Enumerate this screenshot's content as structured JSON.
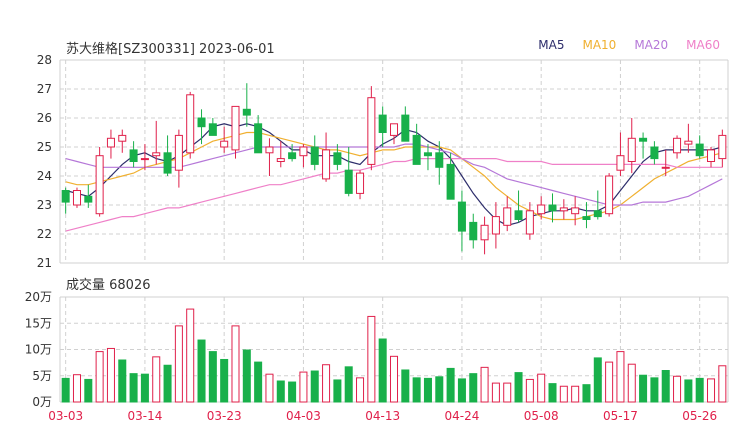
{
  "header": {
    "title": "苏大维格[SZ300331] 2023-06-01"
  },
  "legend": [
    {
      "label": "MA5",
      "color": "#2d2d6b"
    },
    {
      "label": "MA10",
      "color": "#f0b030"
    },
    {
      "label": "MA20",
      "color": "#b577d8"
    },
    {
      "label": "MA60",
      "color": "#ef80c8"
    }
  ],
  "volume_header": {
    "label": "成交量 68026"
  },
  "colors": {
    "up": "#e0204a",
    "down": "#18b04a",
    "grid": "#d0d0d0",
    "axis": "#333333",
    "date": "#e0204a"
  },
  "chart_data": [
    {
      "type": "candlestick",
      "ylim": [
        21,
        28
      ],
      "yticks": [
        "21",
        "22",
        "23",
        "24",
        "25",
        "26",
        "27",
        "28"
      ],
      "xticks": [
        {
          "label": "03-03",
          "index": 0
        },
        {
          "label": "03-14",
          "index": 7
        },
        {
          "label": "03-23",
          "index": 14
        },
        {
          "label": "04-03",
          "index": 21
        },
        {
          "label": "04-13",
          "index": 28
        },
        {
          "label": "04-24",
          "index": 35
        },
        {
          "label": "05-08",
          "index": 42
        },
        {
          "label": "05-17",
          "index": 49
        },
        {
          "label": "05-26",
          "index": 56
        }
      ],
      "ohlc": [
        [
          23.5,
          23.6,
          22.7,
          23.1
        ],
        [
          23.0,
          23.6,
          22.9,
          23.5
        ],
        [
          23.3,
          23.7,
          22.9,
          23.1
        ],
        [
          22.7,
          25.0,
          22.6,
          24.7
        ],
        [
          25.0,
          25.6,
          24.6,
          25.3
        ],
        [
          25.2,
          25.6,
          24.8,
          25.4
        ],
        [
          24.9,
          25.2,
          24.3,
          24.5
        ],
        [
          24.6,
          25.1,
          24.2,
          24.6
        ],
        [
          24.7,
          25.9,
          24.4,
          24.8
        ],
        [
          24.8,
          25.4,
          24.0,
          24.1
        ],
        [
          24.2,
          25.6,
          23.6,
          25.4
        ],
        [
          24.8,
          26.9,
          24.6,
          26.8
        ],
        [
          26.0,
          26.3,
          25.1,
          25.7
        ],
        [
          25.8,
          26.0,
          25.4,
          25.4
        ],
        [
          25.0,
          25.7,
          24.8,
          25.2
        ],
        [
          24.9,
          26.4,
          24.6,
          26.4
        ],
        [
          26.3,
          27.2,
          25.7,
          26.1
        ],
        [
          25.8,
          26.1,
          24.8,
          24.8
        ],
        [
          24.8,
          25.3,
          24.0,
          25.0
        ],
        [
          24.5,
          25.2,
          24.3,
          24.6
        ],
        [
          24.8,
          25.1,
          24.5,
          24.6
        ],
        [
          24.7,
          25.1,
          24.3,
          25.0
        ],
        [
          25.0,
          25.4,
          24.2,
          24.4
        ],
        [
          23.9,
          25.5,
          23.8,
          24.9
        ],
        [
          24.8,
          25.1,
          24.2,
          24.4
        ],
        [
          24.2,
          25.0,
          23.3,
          23.4
        ],
        [
          23.4,
          24.2,
          23.2,
          24.1
        ],
        [
          24.4,
          27.1,
          24.2,
          26.7
        ],
        [
          26.1,
          26.4,
          25.0,
          25.5
        ],
        [
          25.4,
          25.8,
          25.1,
          25.8
        ],
        [
          26.1,
          26.4,
          25.4,
          25.2
        ],
        [
          25.4,
          25.8,
          24.4,
          24.4
        ],
        [
          24.8,
          25.1,
          24.2,
          24.7
        ],
        [
          24.8,
          25.2,
          23.7,
          24.3
        ],
        [
          24.4,
          24.8,
          23.2,
          23.2
        ],
        [
          23.1,
          23.5,
          21.4,
          22.1
        ],
        [
          22.4,
          22.7,
          21.5,
          21.8
        ],
        [
          21.8,
          22.6,
          21.3,
          22.3
        ],
        [
          22.0,
          23.1,
          21.5,
          22.6
        ],
        [
          22.3,
          23.3,
          22.1,
          22.9
        ],
        [
          22.8,
          23.5,
          22.4,
          22.5
        ],
        [
          22.0,
          23.1,
          21.8,
          22.8
        ],
        [
          22.7,
          23.3,
          22.5,
          23.0
        ],
        [
          23.0,
          23.4,
          22.4,
          22.8
        ],
        [
          22.8,
          23.2,
          22.5,
          22.9
        ],
        [
          22.7,
          23.3,
          22.3,
          22.9
        ],
        [
          22.6,
          23.1,
          22.2,
          22.5
        ],
        [
          22.8,
          23.5,
          22.5,
          22.6
        ],
        [
          22.7,
          24.1,
          22.6,
          24.0
        ],
        [
          24.2,
          25.5,
          24.0,
          24.7
        ],
        [
          24.5,
          26.0,
          24.1,
          25.3
        ],
        [
          25.3,
          25.5,
          24.6,
          25.2
        ],
        [
          25.0,
          25.2,
          24.4,
          24.6
        ],
        [
          24.3,
          24.9,
          24.0,
          24.3
        ],
        [
          24.8,
          25.4,
          24.6,
          25.3
        ],
        [
          25.1,
          25.8,
          24.8,
          25.2
        ],
        [
          25.1,
          25.4,
          24.6,
          24.7
        ],
        [
          24.5,
          25.0,
          24.3,
          24.9
        ],
        [
          24.6,
          25.6,
          24.3,
          25.4
        ]
      ],
      "ma5": [
        23.5,
        23.4,
        23.3,
        23.6,
        24.0,
        24.4,
        24.7,
        24.8,
        24.6,
        24.5,
        24.7,
        25.0,
        25.3,
        25.7,
        25.8,
        25.7,
        25.8,
        25.7,
        25.5,
        25.2,
        24.9,
        24.9,
        24.7,
        24.7,
        24.7,
        24.5,
        24.4,
        24.8,
        25.1,
        25.3,
        25.6,
        25.5,
        25.2,
        25.0,
        24.6,
        24.0,
        23.4,
        22.9,
        22.5,
        22.3,
        22.4,
        22.6,
        22.7,
        22.8,
        22.8,
        22.9,
        22.8,
        22.8,
        23.0,
        23.5,
        24.0,
        24.5,
        24.8,
        24.9,
        24.9,
        24.9,
        24.9,
        24.9,
        25.0
      ],
      "ma10": [
        23.8,
        23.7,
        23.7,
        23.8,
        23.9,
        24.0,
        24.1,
        24.3,
        24.4,
        24.5,
        24.6,
        24.8,
        25.0,
        25.2,
        25.3,
        25.4,
        25.5,
        25.5,
        25.4,
        25.3,
        25.2,
        25.1,
        25.0,
        24.9,
        24.9,
        24.8,
        24.7,
        24.8,
        24.9,
        24.9,
        25.0,
        25.0,
        25.0,
        25.0,
        24.9,
        24.6,
        24.3,
        24.0,
        23.6,
        23.3,
        23.0,
        22.8,
        22.6,
        22.5,
        22.5,
        22.5,
        22.6,
        22.7,
        22.8,
        23.0,
        23.3,
        23.6,
        23.9,
        24.1,
        24.3,
        24.5,
        24.6,
        24.7,
        24.8
      ],
      "ma20": [
        24.6,
        24.5,
        24.4,
        24.3,
        24.3,
        24.3,
        24.3,
        24.3,
        24.3,
        24.3,
        24.3,
        24.4,
        24.5,
        24.6,
        24.7,
        24.8,
        24.9,
        25.0,
        25.0,
        25.0,
        25.0,
        25.0,
        25.0,
        25.0,
        25.0,
        25.0,
        25.0,
        25.0,
        25.0,
        25.0,
        25.1,
        25.1,
        25.0,
        24.9,
        24.8,
        24.6,
        24.4,
        24.3,
        24.1,
        23.9,
        23.8,
        23.7,
        23.6,
        23.5,
        23.4,
        23.3,
        23.2,
        23.1,
        23.0,
        23.0,
        23.0,
        23.1,
        23.1,
        23.1,
        23.2,
        23.3,
        23.5,
        23.7,
        23.9
      ],
      "ma60": [
        22.1,
        22.2,
        22.3,
        22.4,
        22.5,
        22.6,
        22.6,
        22.7,
        22.8,
        22.9,
        22.9,
        23.0,
        23.1,
        23.2,
        23.3,
        23.4,
        23.5,
        23.6,
        23.7,
        23.7,
        23.8,
        23.9,
        24.0,
        24.1,
        24.1,
        24.2,
        24.2,
        24.3,
        24.4,
        24.5,
        24.5,
        24.6,
        24.6,
        24.6,
        24.6,
        24.6,
        24.6,
        24.6,
        24.6,
        24.5,
        24.5,
        24.5,
        24.5,
        24.4,
        24.4,
        24.4,
        24.4,
        24.4,
        24.4,
        24.4,
        24.4,
        24.4,
        24.4,
        24.4,
        24.3,
        24.3,
        24.3,
        24.3,
        24.3
      ]
    },
    {
      "type": "bar",
      "ylim": [
        0,
        20
      ],
      "yticks": [
        "0万",
        "5万",
        "10万",
        "15万",
        "20万"
      ],
      "volume_wan": [
        4.5,
        5.2,
        4.3,
        9.6,
        10.2,
        8.0,
        5.4,
        5.3,
        8.6,
        7.0,
        14.5,
        17.7,
        11.8,
        9.6,
        8.1,
        14.5,
        9.9,
        7.6,
        5.3,
        4.0,
        3.8,
        5.7,
        5.9,
        7.1,
        4.2,
        6.7,
        4.6,
        16.3,
        12.0,
        8.7,
        6.1,
        4.6,
        4.5,
        4.8,
        6.4,
        4.4,
        5.4,
        6.6,
        3.6,
        3.6,
        5.6,
        4.3,
        5.3,
        3.5,
        3.0,
        3.0,
        3.3,
        8.4,
        7.6,
        9.6,
        7.2,
        5.1,
        4.6,
        6.0,
        4.9,
        4.2,
        4.5,
        4.4,
        6.9
      ],
      "up": [
        false,
        true,
        false,
        true,
        true,
        false,
        false,
        false,
        true,
        false,
        true,
        true,
        false,
        false,
        false,
        true,
        false,
        false,
        true,
        false,
        false,
        true,
        false,
        true,
        false,
        false,
        true,
        true,
        false,
        true,
        false,
        false,
        false,
        false,
        false,
        false,
        false,
        true,
        true,
        true,
        false,
        true,
        true,
        false,
        true,
        true,
        false,
        false,
        true,
        true,
        true,
        false,
        false,
        false,
        true,
        false,
        false,
        true,
        true
      ]
    }
  ]
}
